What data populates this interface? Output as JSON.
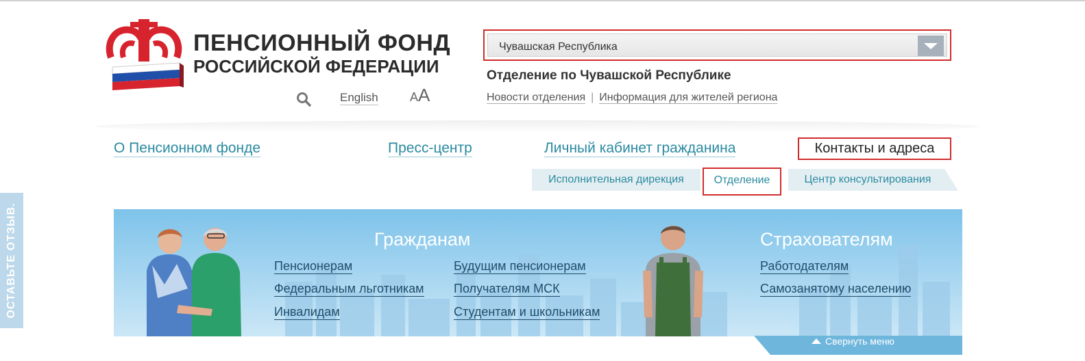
{
  "feedback_tab": {
    "label": "ОСТАВЬТЕ ОТЗЫВ."
  },
  "logo": {
    "line1": "ПЕНСИОННЫЙ ФОНД",
    "line2": "РОССИЙСКОЙ ФЕДЕРАЦИИ"
  },
  "tools": {
    "search_icon": "search-icon",
    "language_link": "English",
    "font_size_small": "A",
    "font_size_large": "A"
  },
  "region": {
    "selected": "Чувашская Республика",
    "branch_title": "Отделение по Чувашской Республике",
    "links": [
      "Новости отделения",
      "Информация для жителей региона"
    ],
    "separator": "|"
  },
  "main_nav": {
    "items": [
      "О Пенсионном фонде",
      "Пресс-центр",
      "Личный кабинет гражданина",
      "Контакты и адреса"
    ],
    "active": "Контакты и адреса"
  },
  "sub_tabs": {
    "items": [
      "Исполнительная дирекция",
      "Отделение",
      "Центр консультирования"
    ],
    "active": "Отделение"
  },
  "banner": {
    "citizens": {
      "title": "Гражданам",
      "col1": [
        "Пенсионерам",
        "Федеральным льготникам",
        "Инвалидам"
      ],
      "col2": [
        "Будущим пенсионерам",
        "Получателям МСК",
        "Студентам и школьникам"
      ]
    },
    "insurers": {
      "title": "Страхователям",
      "links": [
        "Работодателям",
        "Самозанятому населению"
      ]
    },
    "collapse_label": "Свернуть меню"
  },
  "colors": {
    "accent": "#2a8aa0",
    "highlight_border": "#d22b2b",
    "logo_red": "#d7232e",
    "banner_blue": "#7ec3ea"
  }
}
